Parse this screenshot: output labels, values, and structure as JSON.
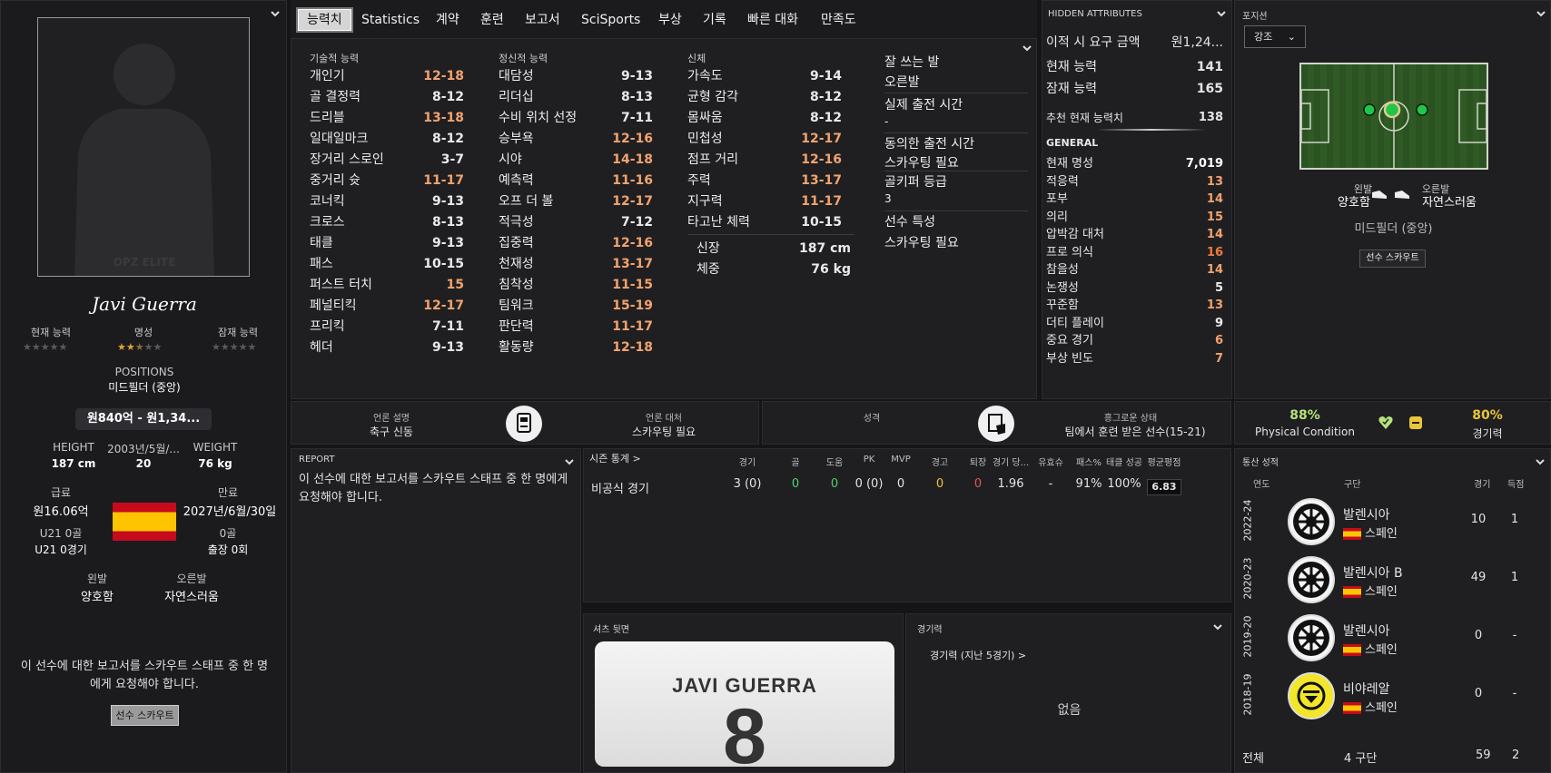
{
  "player": {
    "name": "Javi Guerra",
    "portrait_text": "OPZ ELITE",
    "labels": {
      "current_ability": "현재 능력",
      "reputation": "명성",
      "potential_ability": "잠재 능력"
    },
    "reputation_stars": 2.5,
    "current_ability_stars": 0,
    "potential_ability_stars": 0,
    "positions_label": "POSITIONS",
    "positions_value": "미드필더 (중앙)",
    "value_range": "원840억 - 원1,34...",
    "height_label": "HEIGHT",
    "height": "187 cm",
    "age_label": "2003년/5월/...",
    "age": "20",
    "weight_label": "WEIGHT",
    "weight": "76 kg",
    "wage_label": "급료",
    "wage": "원16.06억",
    "expires_label": "만료",
    "expires": "2027년/6월/30일",
    "u21_goals_label": "U21 0골",
    "u21_apps": "U21 0경기",
    "goals_label": "0골",
    "apps": "출장 0회",
    "left_foot_label": "왼발",
    "left_foot": "양호함",
    "right_foot_label": "오른발",
    "right_foot": "자연스러움",
    "report_note": "이 선수에 대한 보고서를 스카우트 스태프 중 한 명에게 요청해야 합니다.",
    "scout_button": "선수 스카우트"
  },
  "tabs": [
    "능력치",
    "Statistics",
    "계약",
    "훈련",
    "보고서",
    "SciSports",
    "부상",
    "기록",
    "빠른 대화",
    "만족도"
  ],
  "attributes": {
    "technical_title": "기술적 능력",
    "technical": [
      {
        "n": "개인기",
        "v": "12-18",
        "hi": true
      },
      {
        "n": "골 결정력",
        "v": "8-12",
        "hi": false
      },
      {
        "n": "드리블",
        "v": "13-18",
        "hi": true
      },
      {
        "n": "일대일마크",
        "v": "8-12",
        "hi": false
      },
      {
        "n": "장거리 스로인",
        "v": "3-7",
        "hi": false
      },
      {
        "n": "중거리 슛",
        "v": "11-17",
        "hi": true
      },
      {
        "n": "코너킥",
        "v": "9-13",
        "hi": false
      },
      {
        "n": "크로스",
        "v": "8-13",
        "hi": false
      },
      {
        "n": "태클",
        "v": "9-13",
        "hi": false
      },
      {
        "n": "패스",
        "v": "10-15",
        "hi": false
      },
      {
        "n": "퍼스트 터치",
        "v": "15",
        "hi": true
      },
      {
        "n": "페널티킥",
        "v": "12-17",
        "hi": true
      },
      {
        "n": "프리킥",
        "v": "7-11",
        "hi": false
      },
      {
        "n": "헤더",
        "v": "9-13",
        "hi": false
      }
    ],
    "mental_title": "정신적 능력",
    "mental": [
      {
        "n": "대담성",
        "v": "9-13",
        "hi": false
      },
      {
        "n": "리더십",
        "v": "8-13",
        "hi": false
      },
      {
        "n": "수비 위치 선정",
        "v": "7-11",
        "hi": false
      },
      {
        "n": "승부욕",
        "v": "12-16",
        "hi": true
      },
      {
        "n": "시야",
        "v": "14-18",
        "hi": true
      },
      {
        "n": "예측력",
        "v": "11-16",
        "hi": true
      },
      {
        "n": "오프 더 볼",
        "v": "12-17",
        "hi": true
      },
      {
        "n": "적극성",
        "v": "7-12",
        "hi": false
      },
      {
        "n": "집중력",
        "v": "12-16",
        "hi": true
      },
      {
        "n": "천재성",
        "v": "13-17",
        "hi": true
      },
      {
        "n": "침착성",
        "v": "11-15",
        "hi": true
      },
      {
        "n": "팀워크",
        "v": "15-19",
        "hi": true
      },
      {
        "n": "판단력",
        "v": "11-17",
        "hi": true
      },
      {
        "n": "활동량",
        "v": "12-18",
        "hi": true
      }
    ],
    "physical_title": "신체",
    "physical": [
      {
        "n": "가속도",
        "v": "9-14",
        "hi": false
      },
      {
        "n": "균형 감각",
        "v": "8-12",
        "hi": false
      },
      {
        "n": "몸싸움",
        "v": "8-12",
        "hi": false
      },
      {
        "n": "민첩성",
        "v": "12-17",
        "hi": true
      },
      {
        "n": "점프 거리",
        "v": "12-16",
        "hi": true
      },
      {
        "n": "주력",
        "v": "13-17",
        "hi": true
      },
      {
        "n": "지구력",
        "v": "11-17",
        "hi": true
      },
      {
        "n": "타고난 체력",
        "v": "10-15",
        "hi": false
      }
    ],
    "height_label": "신장",
    "height": "187 cm",
    "weight_label": "체중",
    "weight": "76 kg",
    "side": {
      "foot_label": "잘 쓰는 발",
      "foot": "오른발",
      "playtime_label": "실제 출전 시간",
      "playtime": "-",
      "agreed_label": "동의한 출전 시간",
      "agreed": "스카우팅 필요",
      "gk_label": "골키퍼 등급",
      "gk": "3",
      "traits_label": "선수 특성",
      "traits": "스카우팅 필요"
    }
  },
  "hidden": {
    "title": "HIDDEN ATTRIBUTES",
    "fee_label": "이적 시 요구 금액",
    "fee": "원1,24...",
    "ca_label": "현재 능력",
    "ca": "141",
    "pa_label": "잠재 능력",
    "pa": "165",
    "rec_label": "추천 현재 능력치",
    "rec": "138",
    "general_title": "GENERAL",
    "rows": [
      {
        "n": "현재 명성",
        "v": "7,019",
        "c": "#ffffff"
      },
      {
        "n": "적응력",
        "v": "13",
        "c": "#f2a36e"
      },
      {
        "n": "포부",
        "v": "14",
        "c": "#f2a36e"
      },
      {
        "n": "의리",
        "v": "15",
        "c": "#f2a36e"
      },
      {
        "n": "압박감 대처",
        "v": "14",
        "c": "#f2a36e"
      },
      {
        "n": "프로 의식",
        "v": "16",
        "c": "#f07a3c"
      },
      {
        "n": "참을성",
        "v": "14",
        "c": "#f2a36e"
      },
      {
        "n": "논쟁성",
        "v": "5",
        "c": "#eaeaea"
      },
      {
        "n": "꾸준함",
        "v": "13",
        "c": "#f2a36e"
      },
      {
        "n": "더티 플레이",
        "v": "9",
        "c": "#eaeaea"
      },
      {
        "n": "중요 경기",
        "v": "6",
        "c": "#f2a36e"
      },
      {
        "n": "부상 빈도",
        "v": "7",
        "c": "#f2a36e"
      }
    ]
  },
  "position": {
    "title": "포지션",
    "dropdown": "강조",
    "left_foot_label": "왼발",
    "left_foot": "양호함",
    "right_foot_label": "오른발",
    "right_foot": "자연스러움",
    "role": "미드필더 (중앙)",
    "scout_button": "선수 스카우트"
  },
  "media": {
    "desc_label": "언론 설명",
    "desc": "축구 신동",
    "handling_label": "언론 대처",
    "handling": "스카우팅 필요",
    "personality_label": "성격",
    "personality": "",
    "happiness_label": "흥그로운 상태",
    "happiness": "팀에서 훈련 받은 선수(15-21)"
  },
  "condition": {
    "physical_pct": "88%",
    "physical_label": "Physical Condition",
    "match_pct": "80%",
    "match_label": "경기력"
  },
  "report": {
    "title": "REPORT",
    "text": "이 선수에 대한 보고서를 스카우트 스태프 중 한 명에게 요청해야 합니다."
  },
  "season": {
    "title": "시즌 통계 >",
    "headers": [
      "경기",
      "골",
      "도움",
      "PK",
      "MVP",
      "경고",
      "퇴장",
      "경기 당...",
      "유효슈",
      "패스%",
      "태클 성공",
      "평균평점"
    ],
    "row_label": "비공식 경기",
    "row": [
      "3 (0)",
      "0",
      "0",
      "0 (0)",
      "0",
      "0",
      "0",
      "1.96",
      "-",
      "91%",
      "100%",
      "6.83"
    ]
  },
  "shirt": {
    "title": "셔츠 뒷면",
    "name": "JAVI GUERRA",
    "number": "8"
  },
  "form": {
    "title": "경기력",
    "subtitle": "경기력 (지난 5경기) >",
    "empty": "없음"
  },
  "career": {
    "title": "통산 성적",
    "col_year": "연도",
    "col_club": "구단",
    "col_apps": "경기",
    "col_goals": "득점",
    "rows": [
      {
        "year": "2022-24",
        "club": "발렌시아",
        "country": "스페인",
        "apps": "10",
        "goals": "1",
        "badge": "valencia"
      },
      {
        "year": "2020-23",
        "club": "발렌시아 B",
        "country": "스페인",
        "apps": "49",
        "goals": "1",
        "badge": "valencia"
      },
      {
        "year": "2019-20",
        "club": "발렌시아",
        "country": "스페인",
        "apps": "0",
        "goals": "-",
        "badge": "valencia"
      },
      {
        "year": "2018-19",
        "club": "비야레알",
        "country": "스페인",
        "apps": "0",
        "goals": "-",
        "badge": "villarreal"
      }
    ],
    "total_label": "전체",
    "total_clubs": "4 구단",
    "total_apps": "59",
    "total_goals": "2"
  }
}
